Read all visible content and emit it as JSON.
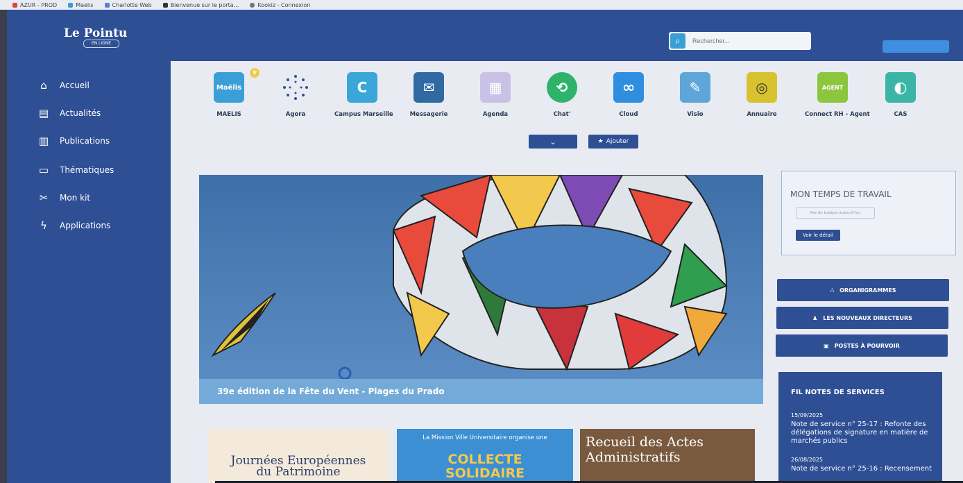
{
  "bookmarks": [
    {
      "label": "AZUR - PROD",
      "color": "#d9453d"
    },
    {
      "label": "Maelis",
      "color": "#3a9fd6"
    },
    {
      "label": "Charlotte Web",
      "color": "#5b7fd1"
    },
    {
      "label": "Bienvenue sur le porta...",
      "color": "#333333"
    },
    {
      "label": "Kookiz - Connexion",
      "color": "#6b7280"
    }
  ],
  "header": {
    "logo": "Le Pointu",
    "logo_sub": "EN LIGNE",
    "search_placeholder": "Rechercher..."
  },
  "sidebar": {
    "items": [
      {
        "label": "Accueil",
        "icon": "home-icon"
      },
      {
        "label": "Actualités",
        "icon": "news-icon"
      },
      {
        "label": "Publications",
        "icon": "book-icon"
      },
      {
        "label": "Thématiques",
        "icon": "folder-icon"
      },
      {
        "label": "Mon kit",
        "icon": "tools-icon"
      },
      {
        "label": "Applications",
        "icon": "bolt-icon"
      }
    ]
  },
  "apps": [
    {
      "label": "MAELIS",
      "tile": "Maëlis",
      "color": "#3a9fd6"
    },
    {
      "label": "Agora",
      "tile": "",
      "color": "#ffffff"
    },
    {
      "label": "Campus Marseille",
      "tile": "C",
      "color": "#3aa7d8"
    },
    {
      "label": "Messagerie",
      "tile": "✉",
      "color": "#2f6aa3"
    },
    {
      "label": "Agenda",
      "tile": "▦",
      "color": "#c9c2e6"
    },
    {
      "label": "Chat'",
      "tile": "⟲",
      "color": "#2fb36b"
    },
    {
      "label": "Cloud",
      "tile": "∞",
      "color": "#2f8ee0"
    },
    {
      "label": "Visio",
      "tile": "✎",
      "color": "#5ea6d9"
    },
    {
      "label": "Annuaire",
      "tile": "◎",
      "color": "#d8c230"
    },
    {
      "label": "Connect RH - Agent",
      "tile": "AGENT",
      "color": "#8cc63f"
    },
    {
      "label": "CAS",
      "tile": "◐",
      "color": "#3bb6a6"
    }
  ],
  "apps_controls": {
    "add_label": "Ajouter",
    "chevron": "⌄"
  },
  "hero": {
    "caption": "39e édition de la Fête du Vent - Plages du Prado"
  },
  "time_card": {
    "title": "MON TEMPS DE TRAVAIL",
    "empty_badge": "Pas de badges aujourd'hui",
    "detail_button": "Voir le détail"
  },
  "side_buttons": [
    {
      "label": "ORGANIGRAMMES",
      "icon": "org-icon"
    },
    {
      "label": "LES NOUVEAUX DIRECTEURS",
      "icon": "user-icon"
    },
    {
      "label": "POSTES À POURVOIR",
      "icon": "briefcase-icon"
    }
  ],
  "fil_notes": {
    "title": "FIL NOTES DE SERVICES",
    "items": [
      {
        "date": "15/09/2025",
        "text": "Note de service n° 25-17 : Refonte des délégations de signature en matière de marchés publics"
      },
      {
        "date": "26/08/2025",
        "text": "Note de service n° 25-16 : Recensement"
      }
    ]
  },
  "tiles": [
    {
      "text": "Journées Européennes du Patrimoine"
    },
    {
      "top": "La Mission Ville Universitaire organise une",
      "big": "COLLECTE SOLIDAIRE"
    },
    {
      "text": "Recueil des Actes Administratifs"
    }
  ]
}
